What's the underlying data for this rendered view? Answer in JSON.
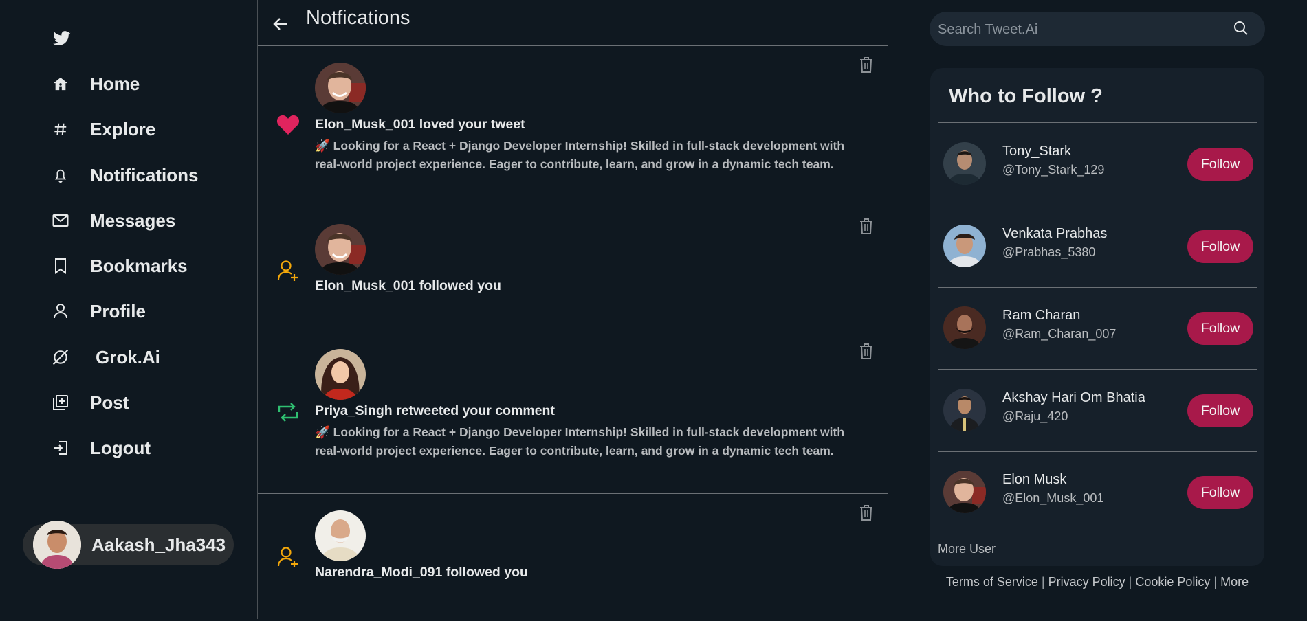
{
  "colors": {
    "background": "#0f1820",
    "card": "#16202a",
    "accent": "#a8194a",
    "like": "#e0245e",
    "retweet": "#2fbf71",
    "follow": "#f4a80a"
  },
  "sidebar": {
    "logo_icon": "twitter-bird-icon",
    "items": [
      {
        "label": "Home",
        "icon": "home-icon"
      },
      {
        "label": "Explore",
        "icon": "hashtag-icon"
      },
      {
        "label": "Notifications",
        "icon": "bell-icon"
      },
      {
        "label": "Messages",
        "icon": "mail-icon"
      },
      {
        "label": "Bookmarks",
        "icon": "bookmark-icon"
      },
      {
        "label": "Profile",
        "icon": "user-icon"
      },
      {
        "label": "Grok.Ai",
        "icon": "grok-icon"
      },
      {
        "label": "Post",
        "icon": "post-icon"
      },
      {
        "label": "Logout",
        "icon": "logout-icon"
      }
    ],
    "user": {
      "name": "Aakash_Jha343"
    }
  },
  "main": {
    "title": "Notfications",
    "notifications": [
      {
        "type": "like",
        "title": "Elon_Musk_001 loved your tweet",
        "body": "🚀 Looking for a React + Django Developer Internship! Skilled in full-stack development with real-world project experience. Eager to contribute, learn, and grow in a dynamic tech team."
      },
      {
        "type": "follow",
        "title": "Elon_Musk_001 followed you",
        "body": ""
      },
      {
        "type": "retweet",
        "title": "Priya_Singh retweeted your comment",
        "body": "🚀 Looking for a React + Django Developer Internship! Skilled in full-stack development with real-world project experience. Eager to contribute, learn, and grow in a dynamic tech team."
      },
      {
        "type": "follow",
        "title": "Narendra_Modi_091 followed you",
        "body": ""
      }
    ]
  },
  "right": {
    "search": {
      "placeholder": "Search Tweet.Ai"
    },
    "who_to_follow": {
      "title": "Who to Follow ?",
      "button_label": "Follow",
      "users": [
        {
          "name": "Tony_Stark",
          "handle": "@Tony_Stark_129"
        },
        {
          "name": "Venkata Prabhas",
          "handle": "@Prabhas_5380"
        },
        {
          "name": "Ram Charan",
          "handle": "@Ram_Charan_007"
        },
        {
          "name": "Akshay Hari Om Bhatia",
          "handle": "@Raju_420"
        },
        {
          "name": "Elon Musk",
          "handle": "@Elon_Musk_001"
        }
      ],
      "more_label": "More User"
    },
    "footer": {
      "terms": "Terms of Service",
      "privacy": "Privacy Policy",
      "cookie": "Cookie Policy",
      "more": "More",
      "separator": "|"
    }
  }
}
